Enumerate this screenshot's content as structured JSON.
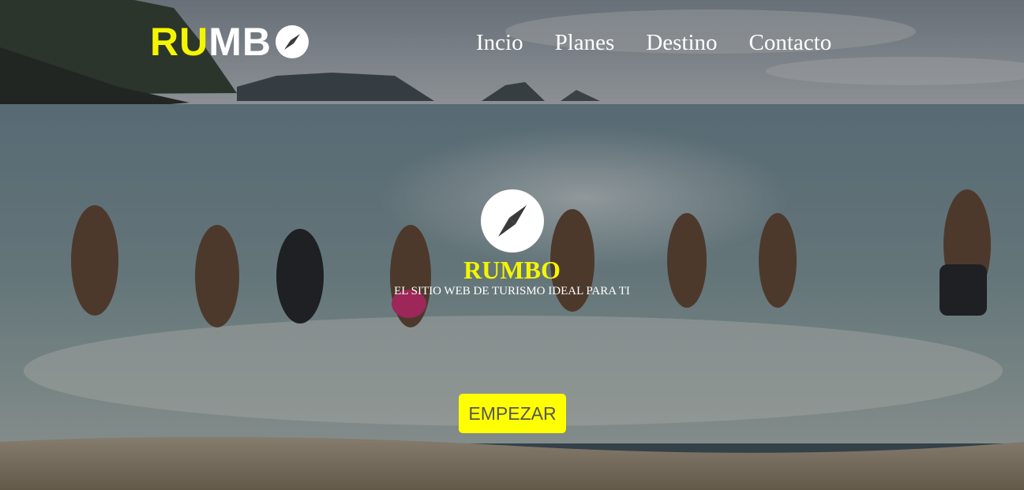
{
  "header": {
    "logo": {
      "part1": "RU",
      "part2": "MB",
      "icon": "compass-icon"
    },
    "nav": [
      "Incio",
      "Planes",
      "Destino",
      "Contacto"
    ]
  },
  "hero": {
    "icon": "compass-icon",
    "title": "RUMBO",
    "tagline": "EL SITIO WEB DE TURISMO IDEAL PARA TI",
    "button_label": "EMPEZAR"
  },
  "colors": {
    "accent": "#f5f500",
    "button_bg": "#ffff00",
    "button_text": "#555555",
    "text": "#ffffff"
  }
}
